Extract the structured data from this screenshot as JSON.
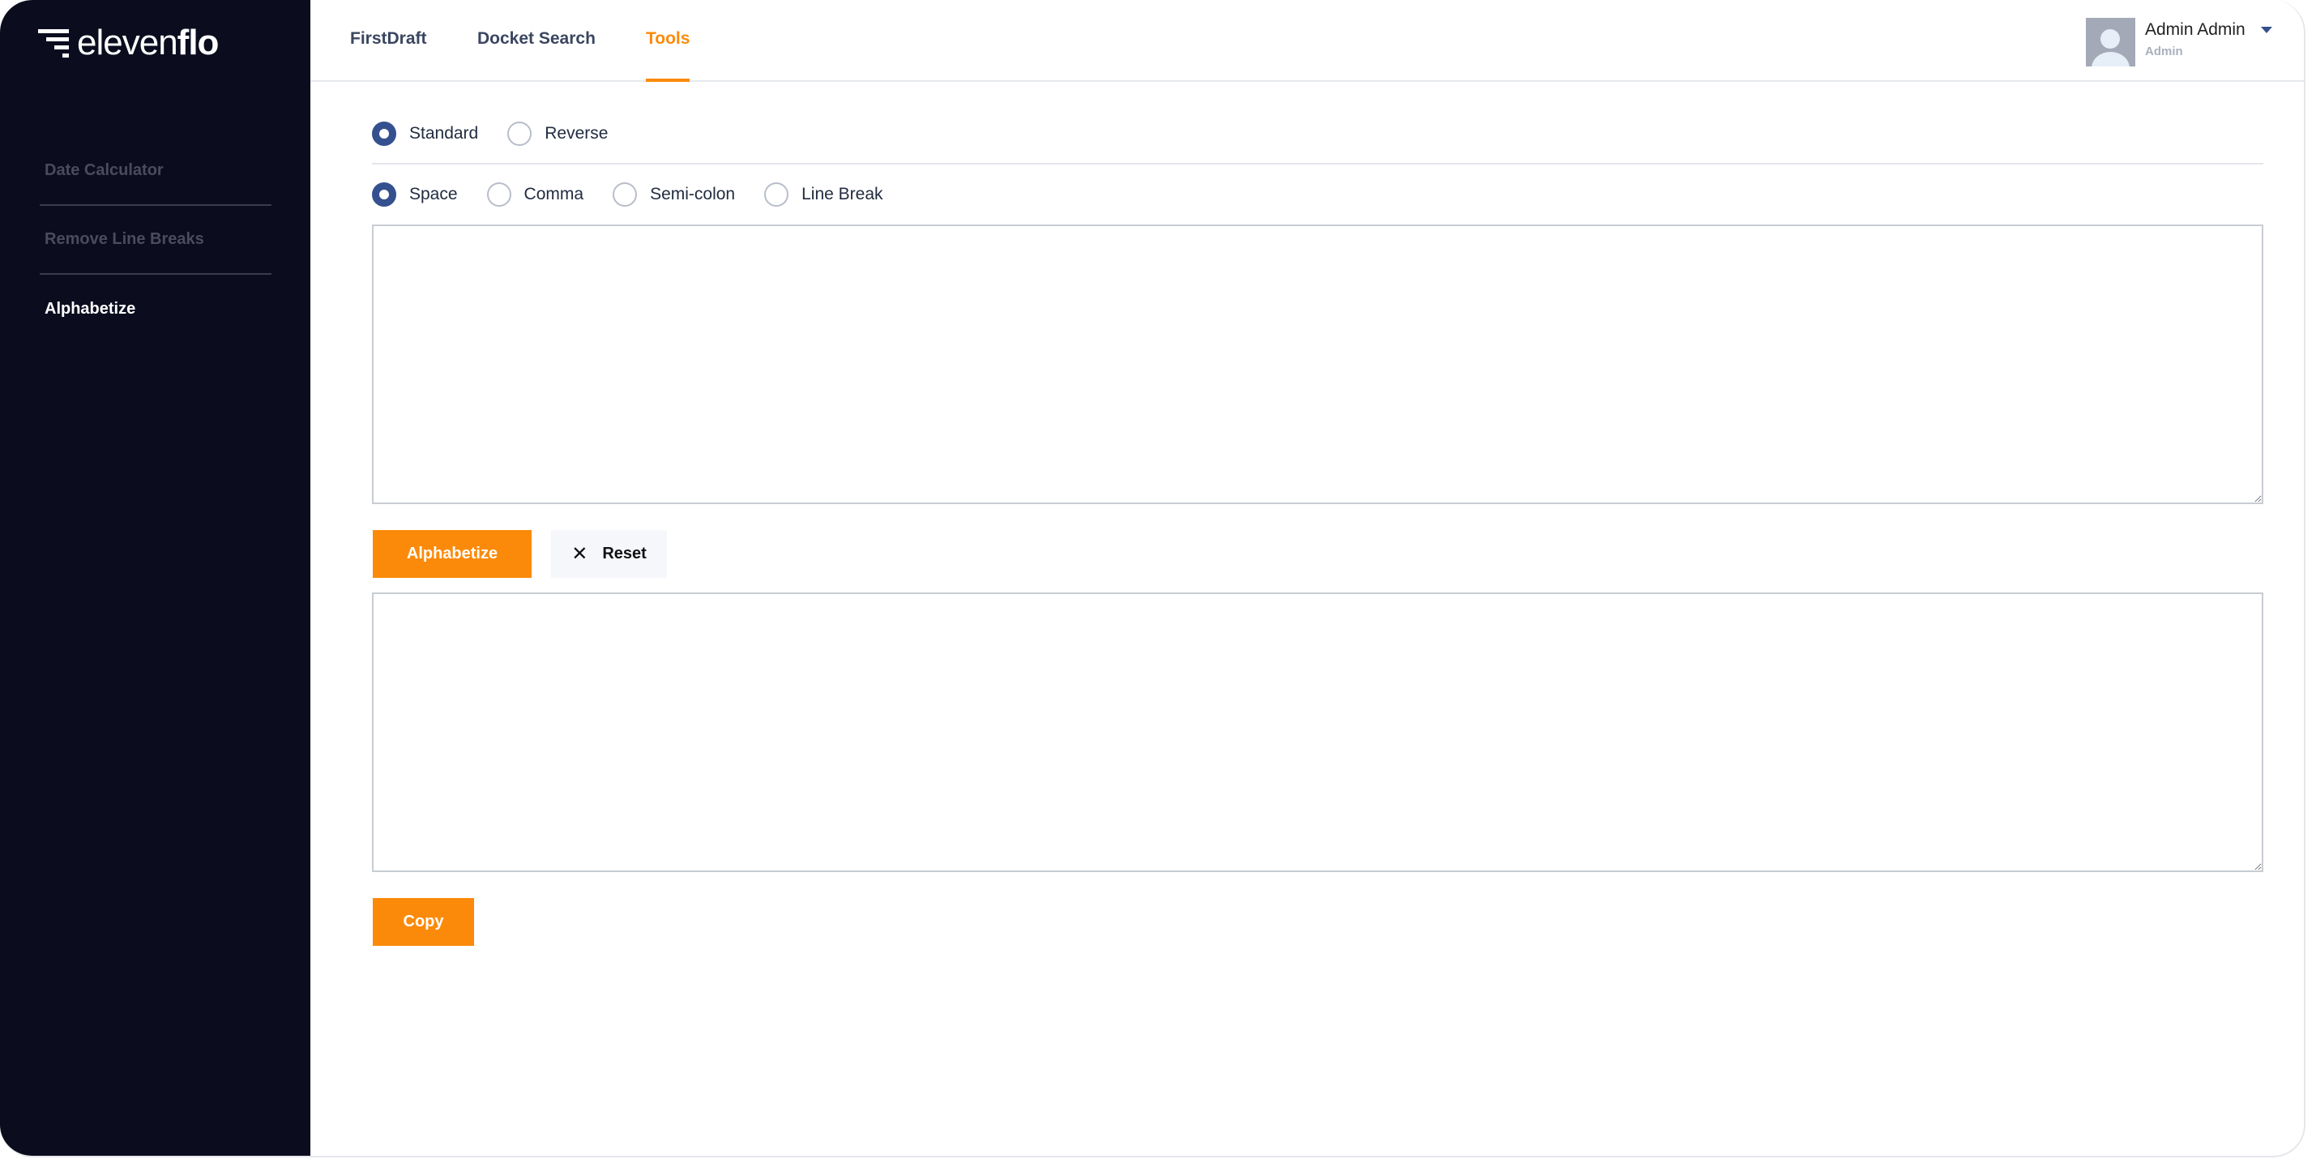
{
  "brand": {
    "logo_light": "eleven",
    "logo_bold": "flo"
  },
  "sidebar": {
    "items": [
      {
        "label": "Date Calculator",
        "active": false
      },
      {
        "label": "Remove Line Breaks",
        "active": false
      },
      {
        "label": "Alphabetize",
        "active": true
      }
    ]
  },
  "header": {
    "nav": [
      {
        "label": "FirstDraft"
      },
      {
        "label": "Docket Search"
      },
      {
        "label": "Tools",
        "active": true
      }
    ],
    "user": {
      "name": "Admin Admin",
      "role": "Admin"
    }
  },
  "main": {
    "order_options": [
      {
        "label": "Standard",
        "checked": true
      },
      {
        "label": "Reverse",
        "checked": false
      }
    ],
    "delimiter_options": [
      {
        "label": "Space",
        "checked": true
      },
      {
        "label": "Comma",
        "checked": false
      },
      {
        "label": "Semi-colon",
        "checked": false
      },
      {
        "label": "Line Break",
        "checked": false
      }
    ],
    "input_value": "",
    "output_value": "",
    "alphabetize_label": "Alphabetize",
    "reset_label": "Reset",
    "copy_label": "Copy"
  },
  "colors": {
    "accent": "#fb8a0a",
    "sidebar_bg": "#0b0d1f",
    "radio": "#34508f"
  }
}
